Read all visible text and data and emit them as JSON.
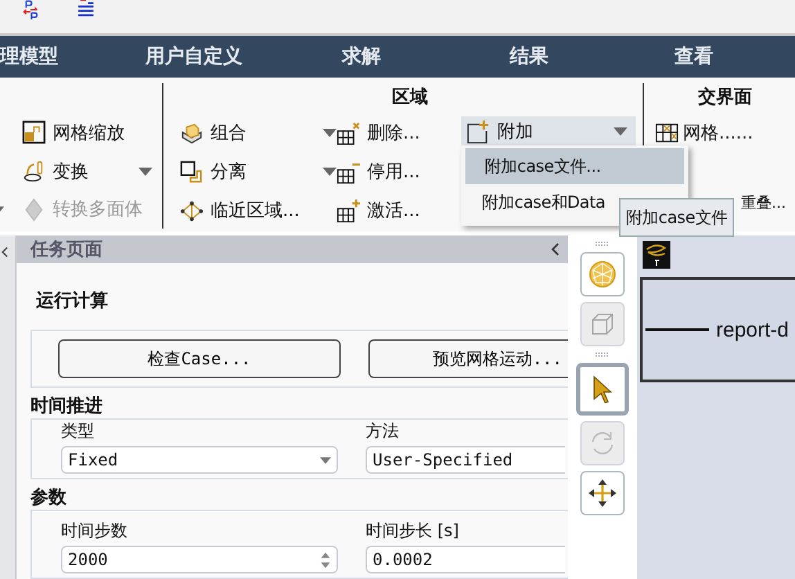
{
  "menu_tabs": [
    {
      "label": "理模型"
    },
    {
      "label": "用户自定义"
    },
    {
      "label": "求解"
    },
    {
      "label": "结果"
    },
    {
      "label": "查看"
    }
  ],
  "ribbon": {
    "left_items": [
      {
        "label": "网格缩放",
        "kind": "scale",
        "dropdown": false,
        "disabled": false
      },
      {
        "label": "变换",
        "kind": "transform",
        "dropdown": true,
        "disabled": false
      },
      {
        "label": "转换多面体",
        "kind": "polyhedra",
        "dropdown": false,
        "disabled": true
      }
    ],
    "zone_title": "区域",
    "zone_columns": [
      [
        {
          "label": "组合",
          "kind": "combine",
          "dropdown": true
        },
        {
          "label": "分离",
          "kind": "separate",
          "dropdown": true
        },
        {
          "label": "临近区域...",
          "kind": "adjacency",
          "dropdown": false
        }
      ],
      [
        {
          "label": "删除...",
          "kind": "delete",
          "dropdown": false
        },
        {
          "label": "停用...",
          "kind": "deactivate",
          "dropdown": false
        },
        {
          "label": "激活...",
          "kind": "activate",
          "dropdown": false
        }
      ],
      [
        {
          "label": "附加",
          "kind": "append",
          "dropdown": true,
          "expanded": true
        }
      ]
    ],
    "interface_title": "交界面",
    "interface_items": [
      {
        "label": "网格......"
      },
      {
        "label": "重叠..."
      }
    ]
  },
  "dropdown_menu": [
    {
      "label": "附加case文件...",
      "selected": true
    },
    {
      "label": "附加case和Data",
      "selected": false
    }
  ],
  "tooltip": "附加case文件",
  "task_page": {
    "title": "任务页面",
    "heading": "运行计算",
    "buttons": [
      "检查Case...",
      "预览网格运动..."
    ],
    "time_advance": {
      "title": "时间推进",
      "type_label": "类型",
      "type_value": "Fixed",
      "method_label": "方法",
      "method_value": "User-Specified"
    },
    "parameters": {
      "title": "参数",
      "steps_label": "时间步数",
      "steps_value": "2000",
      "size_label": "时间步长 [s]",
      "size_value": "0.0002"
    }
  },
  "view_tools": [
    {
      "kind": "mesh",
      "selected": false,
      "disabled": false
    },
    {
      "kind": "cube",
      "selected": false,
      "disabled": true
    },
    {
      "kind": "pointer",
      "selected": true,
      "disabled": false
    },
    {
      "kind": "rotate",
      "selected": false,
      "disabled": true
    },
    {
      "kind": "pan",
      "selected": false,
      "disabled": false
    }
  ],
  "graphics": {
    "legend_label": "report-d"
  }
}
